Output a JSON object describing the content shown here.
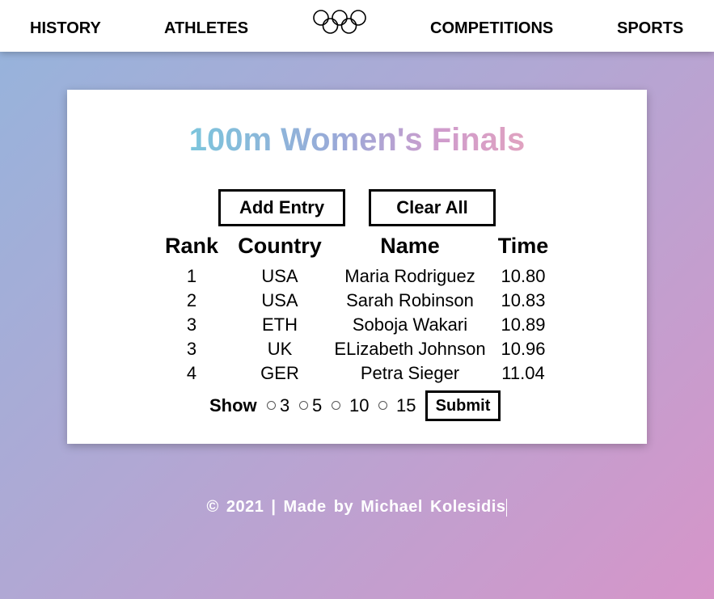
{
  "nav": {
    "history": "HISTORY",
    "athletes": "ATHLETES",
    "logo_icon": "olympic-rings-icon",
    "competitions": "COMPETITIONS",
    "sports": "SPORTS"
  },
  "main": {
    "title": "100m Women's Finals",
    "add_entry_label": "Add Entry",
    "clear_all_label": "Clear All",
    "table": {
      "headers": [
        "Rank",
        "Country",
        "Name",
        "Time"
      ],
      "rows": [
        [
          "1",
          "USA",
          "Maria Rodriguez",
          "10.80"
        ],
        [
          "2",
          "USA",
          "Sarah Robinson",
          "10.83"
        ],
        [
          "3",
          "ETH",
          "Soboja Wakari",
          "10.89"
        ],
        [
          "3",
          "UK",
          "ELizabeth Johnson",
          "10.96"
        ],
        [
          "4",
          "GER",
          "Petra Sieger",
          "11.04"
        ]
      ]
    },
    "show": {
      "label": "Show",
      "options": [
        "3",
        "5",
        "10",
        "15"
      ],
      "submit_label": "Submit"
    }
  },
  "footer": {
    "text": "© 2021 | Made by Michael Kolesidis"
  },
  "colors": {
    "title_gradient_start": "#7cc5dc",
    "title_gradient_end": "#e0a2c0",
    "background_start": "#95b4dc",
    "background_end": "#d695c9"
  }
}
